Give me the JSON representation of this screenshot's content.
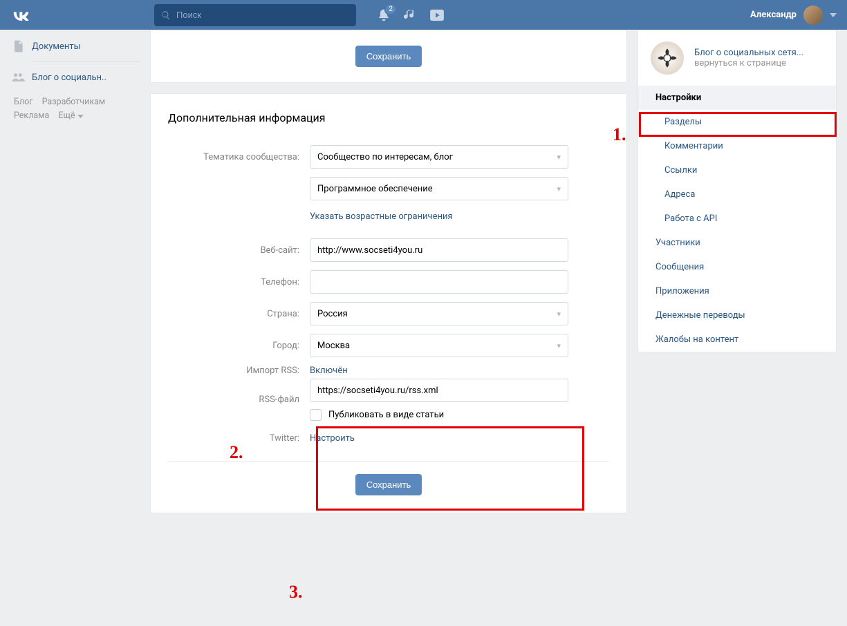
{
  "header": {
    "search_placeholder": "Поиск",
    "badge": "2",
    "user_name": "Александр"
  },
  "left_nav": {
    "docs": "Документы",
    "blog": "Блог о социальн..",
    "footer": {
      "blog": "Блог",
      "devs": "Разработчикам",
      "ads": "Реклама",
      "more": "Ещё"
    }
  },
  "main": {
    "save_btn": "Сохранить",
    "section_title": "Дополнительная информация",
    "labels": {
      "topic": "Тематика сообщества:",
      "website": "Веб-сайт:",
      "phone": "Телефон:",
      "country": "Страна:",
      "city": "Город:",
      "rss_import": "Импорт RSS:",
      "rss_file": "RSS-файл",
      "twitter": "Twitter:"
    },
    "values": {
      "topic1": "Сообщество по интересам, блог",
      "topic2": "Программное обеспечение",
      "age_link": "Указать возрастные ограничения",
      "website": "http://www.socseti4you.ru",
      "phone": "",
      "country": "Россия",
      "city": "Москва",
      "rss_enabled": "Включён",
      "rss_file": "https://socseti4you.ru/rss.xml",
      "publish_article": "Публиковать в виде статьи",
      "twitter_config": "Настроить"
    }
  },
  "right": {
    "community_title": "Блог о социальных сетя...",
    "community_sub": "вернуться к странице",
    "nav": {
      "settings": "Настройки",
      "sections": "Разделы",
      "comments": "Комментарии",
      "links": "Ссылки",
      "addresses": "Адреса",
      "api": "Работа с API",
      "members": "Участники",
      "messages": "Сообщения",
      "apps": "Приложения",
      "money": "Денежные переводы",
      "complaints": "Жалобы на контент"
    }
  },
  "annotations": {
    "a1": "1.",
    "a2": "2.",
    "a3": "3."
  }
}
